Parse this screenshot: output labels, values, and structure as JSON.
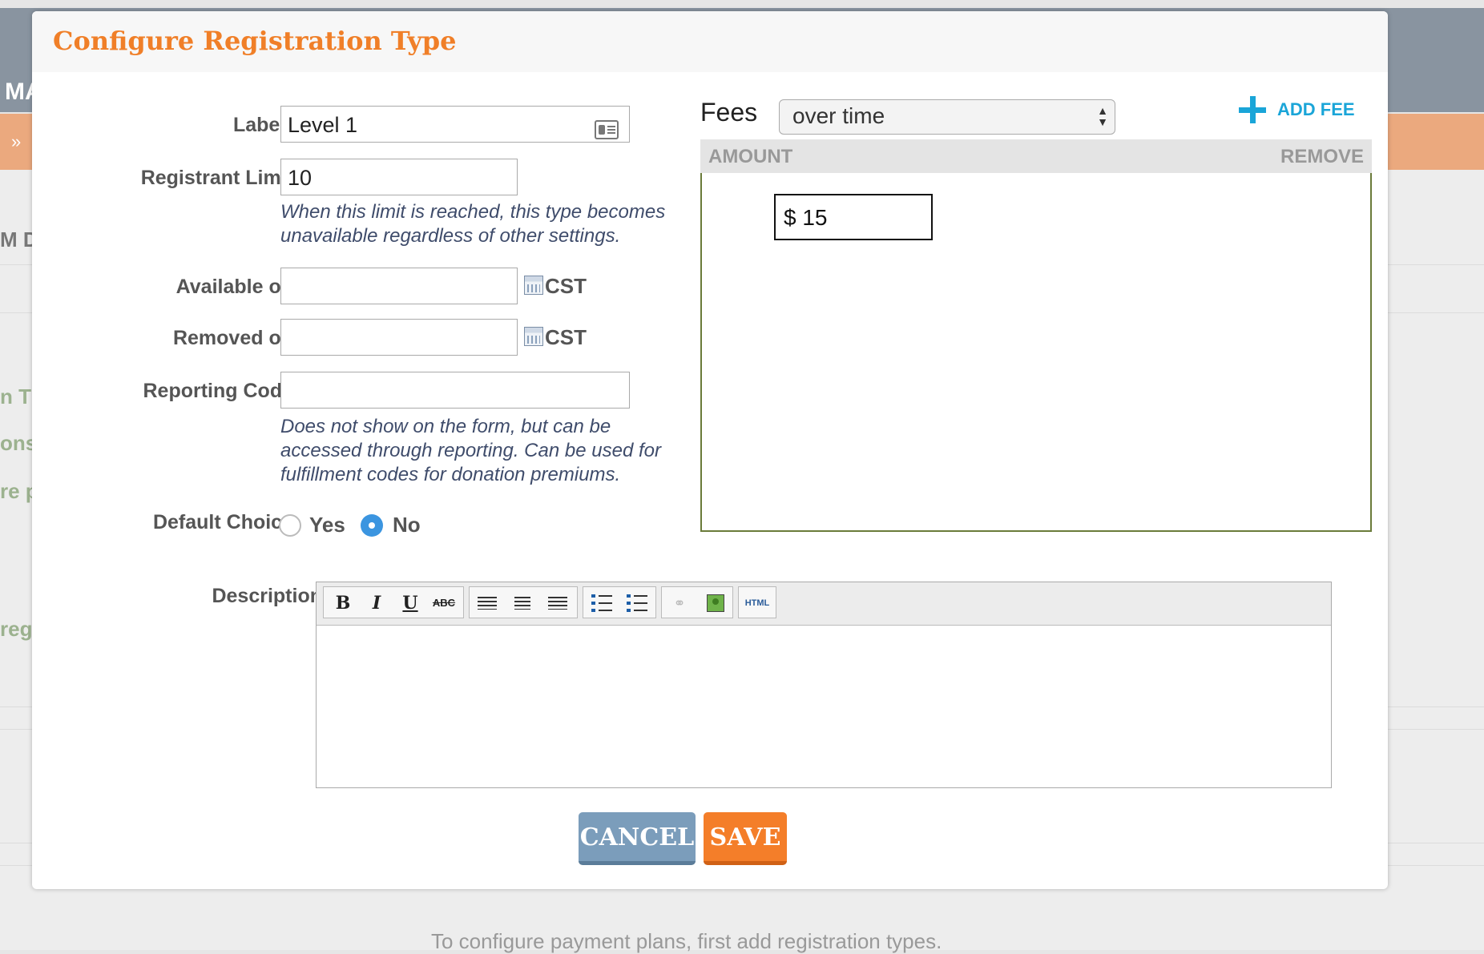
{
  "background": {
    "topbar_title": "MA",
    "orange_chevron": "»",
    "left_fragments": [
      "M D",
      "n T",
      "ons",
      "re p",
      "reg"
    ],
    "footer_text": "To configure payment plans, first add registration types."
  },
  "modal": {
    "title": "Configure Registration Type",
    "form": {
      "label": {
        "label": "Label*",
        "value": "Level 1"
      },
      "registrant_limit": {
        "label": "Registrant Limit",
        "value": "10",
        "hint": [
          "When this limit is reached, this type becomes",
          "unavailable regardless of other settings."
        ]
      },
      "available_on": {
        "label": "Available on",
        "value": "",
        "timezone": "CST"
      },
      "removed_on": {
        "label": "Removed on",
        "value": "",
        "timezone": "CST"
      },
      "reporting_code": {
        "label": "Reporting Code",
        "value": "",
        "hint": [
          "Does not show on the form, but can be",
          "accessed through reporting. Can be used for",
          "fulfillment codes for donation premiums."
        ]
      },
      "default_choice": {
        "label": "Default Choice",
        "yes": "Yes",
        "no": "No",
        "selected": "No"
      },
      "description": {
        "label": "Description",
        "html_button": "HTML"
      }
    },
    "fees": {
      "label": "Fees",
      "mode": "over time",
      "add_fee": "ADD FEE",
      "columns": {
        "amount": "AMOUNT",
        "remove": "REMOVE"
      },
      "rows": [
        {
          "amount": "$ 15"
        }
      ]
    },
    "buttons": {
      "cancel": "CANCEL",
      "save": "SAVE"
    }
  },
  "colors": {
    "title": "#f07f28",
    "cancel": "#7b9dbb",
    "save": "#f47e29",
    "add_fee": "#1aa5d8",
    "radio_selected": "#3b95e0"
  }
}
